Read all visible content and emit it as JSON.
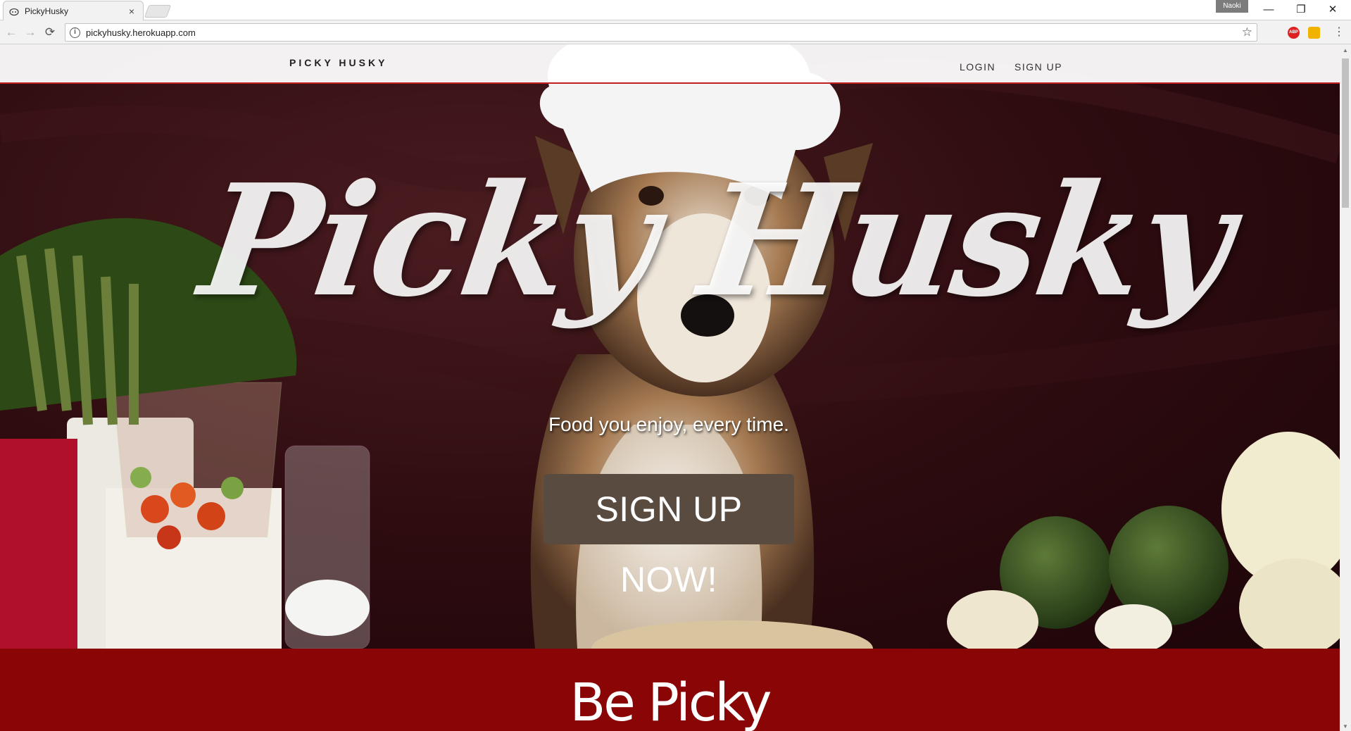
{
  "browser": {
    "tab_title": "PickyHusky",
    "tab_close": "×",
    "profile_name": "Naoki",
    "url": "pickyhusky.herokuapp.com",
    "back_icon": "←",
    "forward_icon": "→",
    "reload_icon": "⟳",
    "star_icon": "☆",
    "minimize": "—",
    "restore": "❐",
    "close": "✕",
    "abp_label": "ABP"
  },
  "site": {
    "brand": "PICKY HUSKY",
    "nav": {
      "login": "LOGIN",
      "signup": "SIGN UP"
    },
    "hero": {
      "title": "Picky Husky",
      "tagline": "Food you enjoy, every time.",
      "cta": "SIGN UP NOW!"
    },
    "section_heading": "Be Picky"
  },
  "colors": {
    "accent_red": "#8a0606",
    "cta_brown": "#5a4b41",
    "nav_border": "#c02020"
  }
}
